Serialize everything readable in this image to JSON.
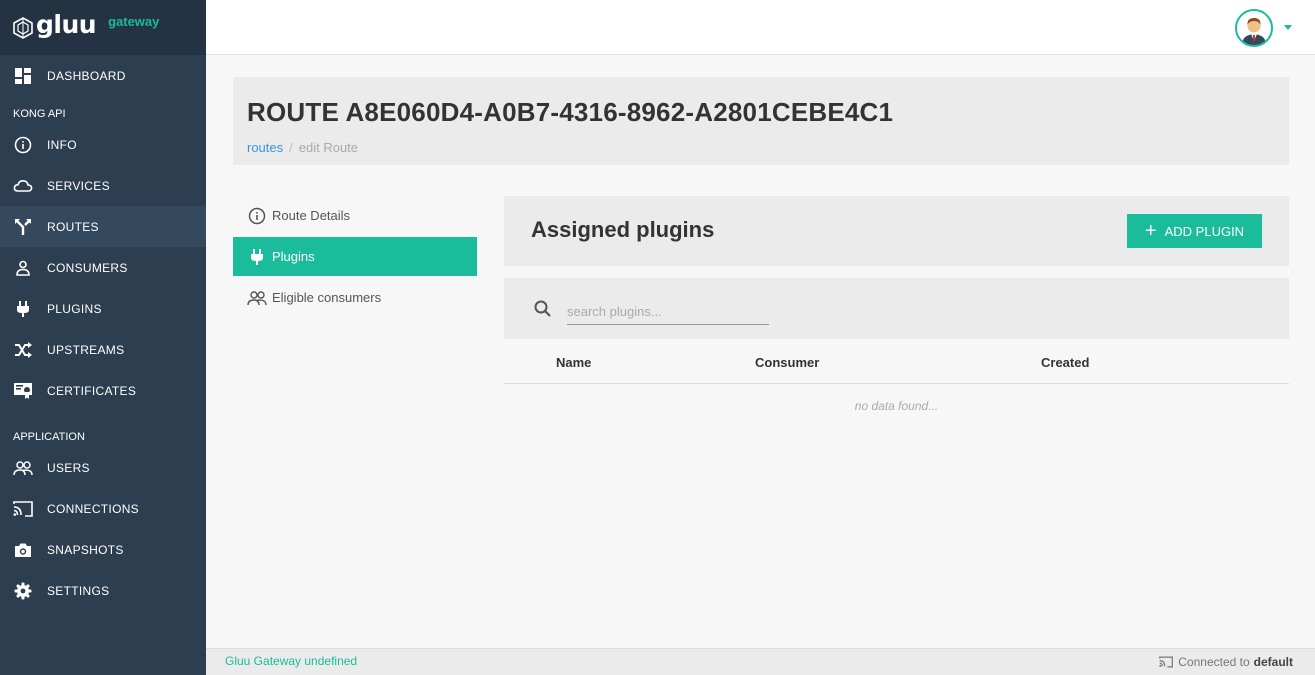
{
  "brand": {
    "logo_text": "gluu",
    "sub": "gateway"
  },
  "sidebar": {
    "top_items": [
      {
        "label": "DASHBOARD",
        "icon": "dashboard-icon"
      }
    ],
    "section_kong": "KONG API",
    "kong_items": [
      {
        "label": "INFO",
        "icon": "info-icon"
      },
      {
        "label": "SERVICES",
        "icon": "cloud-icon"
      },
      {
        "label": "ROUTES",
        "icon": "routes-icon",
        "active": true
      },
      {
        "label": "CONSUMERS",
        "icon": "user-icon"
      },
      {
        "label": "PLUGINS",
        "icon": "plug-icon"
      },
      {
        "label": "UPSTREAMS",
        "icon": "shuffle-icon"
      },
      {
        "label": "CERTIFICATES",
        "icon": "certificate-icon"
      }
    ],
    "section_app": "APPLICATION",
    "app_items": [
      {
        "label": "USERS",
        "icon": "users-icon"
      },
      {
        "label": "CONNECTIONS",
        "icon": "cast-icon"
      },
      {
        "label": "SNAPSHOTS",
        "icon": "camera-icon"
      },
      {
        "label": "SETTINGS",
        "icon": "gear-icon"
      }
    ]
  },
  "header": {
    "title": "ROUTE A8E060D4-A0B7-4316-8962-A2801CEBE4C1",
    "breadcrumb_link": "routes",
    "breadcrumb_sep": "/",
    "breadcrumb_current": "edit Route"
  },
  "tabs": [
    {
      "label": "Route Details",
      "icon": "info-icon"
    },
    {
      "label": "Plugins",
      "icon": "plug-icon",
      "active": true
    },
    {
      "label": "Eligible consumers",
      "icon": "users-icon"
    }
  ],
  "plugins_panel": {
    "title": "Assigned plugins",
    "add_button": "ADD PLUGIN",
    "search_placeholder": "search plugins...",
    "columns": [
      "Name",
      "Consumer",
      "Created"
    ],
    "empty_text": "no data found..."
  },
  "footer": {
    "version": "Gluu Gateway undefined",
    "connected_prefix": "Connected to",
    "connection": "default"
  },
  "colors": {
    "accent": "#1abc9c",
    "sidebar": "#2c3e50",
    "link": "#3498db"
  }
}
